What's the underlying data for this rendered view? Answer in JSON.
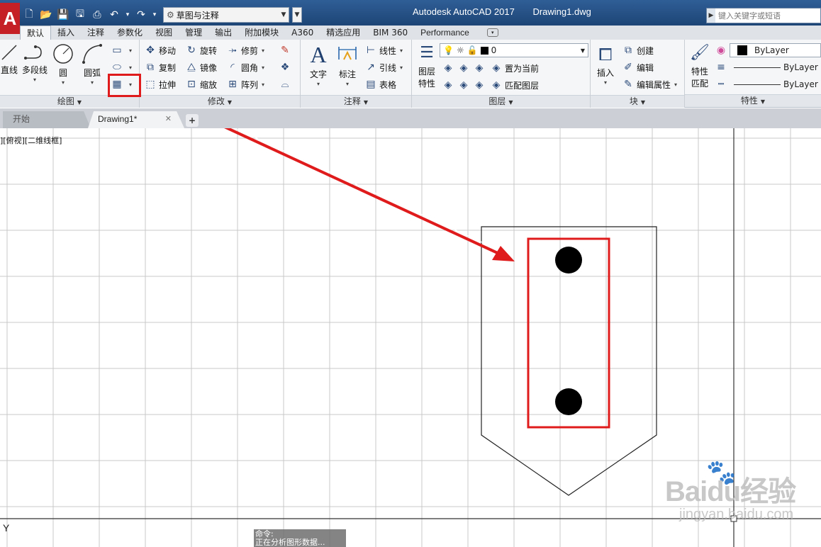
{
  "titlebar": {
    "app_logo": "A",
    "workspace": "草图与注释",
    "app_name": "Autodesk AutoCAD 2017",
    "document_name": "Drawing1.dwg",
    "search_placeholder": "键入关键字或短语"
  },
  "ribbon_tabs": [
    "默认",
    "插入",
    "注释",
    "参数化",
    "视图",
    "管理",
    "输出",
    "附加模块",
    "A360",
    "精选应用",
    "BIM 360",
    "Performance"
  ],
  "ribbon_active_tab": "默认",
  "panels": {
    "draw": {
      "title": "绘图",
      "line": "直线",
      "polyline": "多段线",
      "circle": "圆",
      "arc": "圆弧"
    },
    "modify": {
      "title": "修改",
      "move": "移动",
      "rotate": "旋转",
      "trim": "修剪",
      "copy": "复制",
      "mirror": "镜像",
      "fillet": "圆角",
      "stretch": "拉伸",
      "scale": "缩放",
      "array": "阵列"
    },
    "annotation": {
      "title": "注释",
      "text": "文字",
      "dimension": "标注",
      "linear": "线性",
      "leader": "引线",
      "table": "表格"
    },
    "layers": {
      "title": "图层",
      "layer_properties_line1": "图层",
      "layer_properties_line2": "特性",
      "current_layer": "0",
      "set_current": "置为当前",
      "match_layer": "匹配图层"
    },
    "block": {
      "title": "块",
      "insert": "插入",
      "create": "创建",
      "edit": "编辑",
      "edit_attributes": "编辑属性"
    },
    "properties": {
      "title": "特性",
      "match_line1": "特性",
      "match_line2": "匹配",
      "color": "ByLayer",
      "linetype": "ByLayer",
      "lineweight": "ByLayer"
    }
  },
  "file_tabs": {
    "start": "开始",
    "drawing": "Drawing1*",
    "add": "+"
  },
  "canvas": {
    "viewport_label": "][俯视][二维线框]",
    "ucs_axis": "Y",
    "command_label": "命令:",
    "command_text": "正在分析图形数据..."
  },
  "watermark": {
    "main": "Baidu经验",
    "sub": "jingyan.baidu.com"
  },
  "colors": {
    "highlight": "#e01b1b",
    "title_bar": "#1d4576",
    "logo": "#c62027"
  }
}
